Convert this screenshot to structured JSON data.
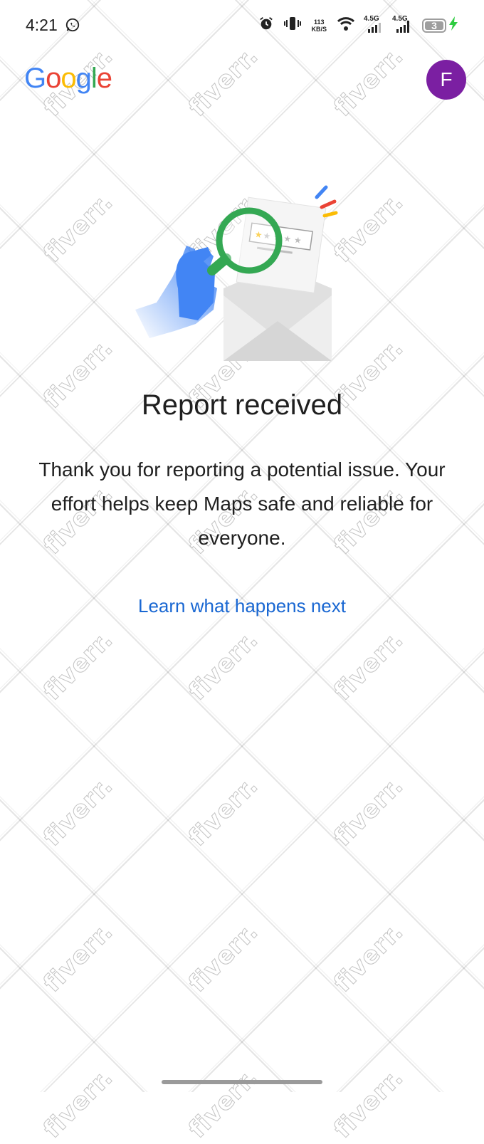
{
  "status_bar": {
    "time": "4:21",
    "net_speed_value": "113",
    "net_speed_unit": "KB/S",
    "signal1_label": "4.5G",
    "signal2_label": "4.5G",
    "battery_level": "3",
    "icons": [
      "whatsapp-icon",
      "alarm-icon",
      "vibrate-icon",
      "wifi-icon",
      "signal-icon",
      "battery-icon",
      "charging-bolt-icon"
    ]
  },
  "header": {
    "logo_letters": [
      "G",
      "o",
      "o",
      "g",
      "l",
      "e"
    ],
    "logo_colors": [
      "#4285F4",
      "#EA4335",
      "#FBBC05",
      "#4285F4",
      "#34A853",
      "#EA4335"
    ],
    "avatar_initial": "F",
    "avatar_color": "#7B1FA2"
  },
  "main": {
    "title": "Report received",
    "message": "Thank you for reporting a potential issue. Your effort helps keep Maps safe and reliable for everyone.",
    "link_label": "Learn what happens next",
    "link_color": "#1967D2"
  },
  "watermark": {
    "text": "fiverr."
  }
}
